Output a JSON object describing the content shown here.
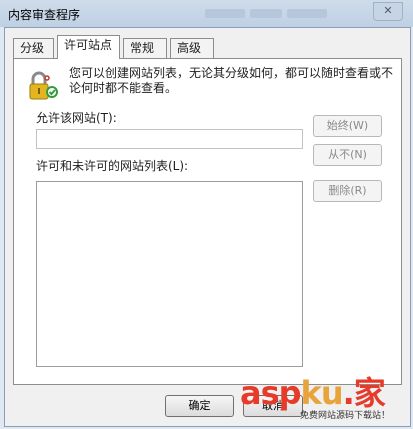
{
  "window": {
    "title": "内容审查程序",
    "close_glyph": "✕"
  },
  "tabs": [
    {
      "label": "分级",
      "active": false
    },
    {
      "label": "许可站点",
      "active": true
    },
    {
      "label": "常规",
      "active": false
    },
    {
      "label": "高级",
      "active": false
    }
  ],
  "info_text": "您可以创建网站列表，无论其分级如何，都可以随时查看或不论何时都不能查看。",
  "allow_site_label": "允许该网站(T):",
  "allow_site_value": "",
  "list_label": "许可和未许可的网站列表(L):",
  "buttons": {
    "always": "始终(W)",
    "never": "从不(N)",
    "delete": "删除(R)",
    "ok": "确定",
    "cancel": "取消"
  },
  "watermark": {
    "logo_asp": "asp",
    "logo_k": "ku",
    "logo_cn": ".家",
    "sub": "免费网站源码下载站！"
  },
  "icons": {
    "lock": "lock-icon",
    "close": "close-icon"
  }
}
